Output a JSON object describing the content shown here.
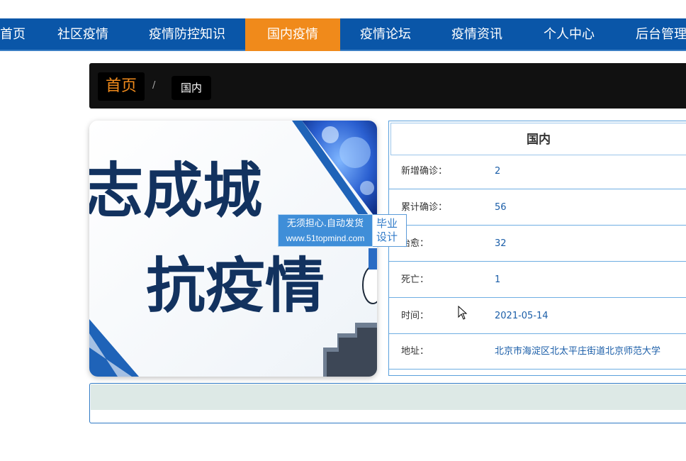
{
  "nav": {
    "items": [
      {
        "label": "首页"
      },
      {
        "label": "社区疫情"
      },
      {
        "label": "疫情防控知识"
      },
      {
        "label": "国内疫情",
        "active": true
      },
      {
        "label": "疫情论坛"
      },
      {
        "label": "疫情资讯"
      },
      {
        "label": "个人中心"
      },
      {
        "label": "后台管理"
      }
    ]
  },
  "breadcrumb": {
    "home": "首页",
    "separator": "/",
    "current": "国内"
  },
  "poster": {
    "line1": "志成城",
    "line2": "抗疫情"
  },
  "detail": {
    "title": "国内",
    "rows": [
      {
        "label": "新增确诊：",
        "value": "2"
      },
      {
        "label": "累计确诊：",
        "value": "56"
      },
      {
        "label": "治愈：",
        "value": "32"
      },
      {
        "label": "死亡：",
        "value": "1"
      },
      {
        "label": "时间：",
        "value": "2021-05-14"
      },
      {
        "label": "地址：",
        "value": "北京市海淀区北太平庄街道北京师范大学"
      }
    ]
  },
  "watermark": {
    "line1": "无须担心.自动发货",
    "line2": "www.51topmind.com",
    "side": "毕业设计"
  },
  "colors": {
    "nav_bg": "#0a56a8",
    "nav_active": "#f08a1b",
    "accent_text": "#1b5ea8"
  }
}
